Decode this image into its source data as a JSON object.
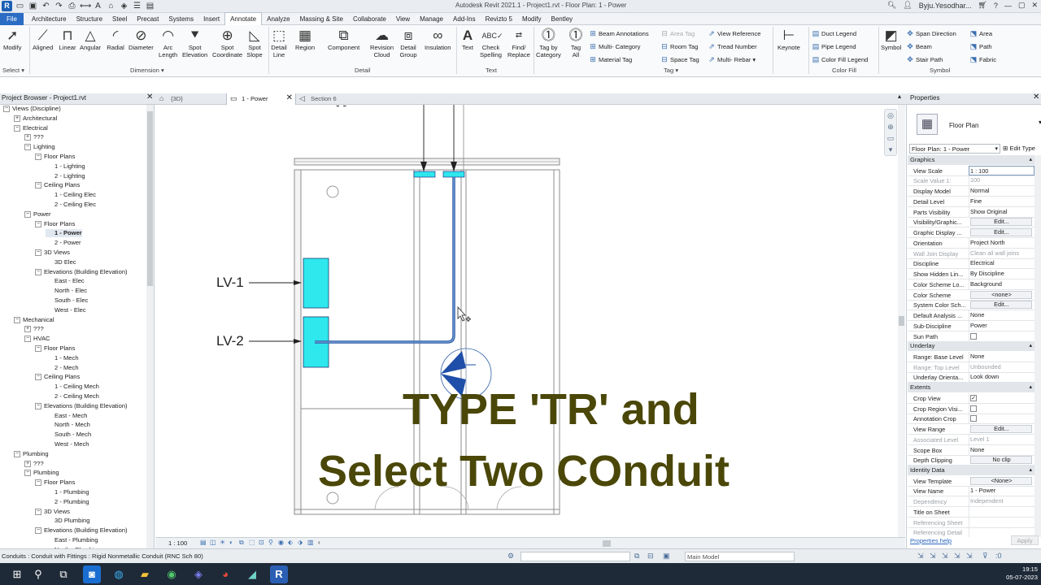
{
  "window": {
    "title": "Autodesk Revit 2021.1 - Project1.rvt - Floor Plan: 1 - Power",
    "user": "Byju.Yesodhar..."
  },
  "tabs": [
    {
      "label": "File"
    },
    {
      "label": "Architecture"
    },
    {
      "label": "Structure"
    },
    {
      "label": "Steel"
    },
    {
      "label": "Precast"
    },
    {
      "label": "Systems"
    },
    {
      "label": "Insert"
    },
    {
      "label": "Annotate"
    },
    {
      "label": "Analyze"
    },
    {
      "label": "Massing & Site"
    },
    {
      "label": "Collaborate"
    },
    {
      "label": "View"
    },
    {
      "label": "Manage"
    },
    {
      "label": "Add-Ins"
    },
    {
      "label": "Revizto 5"
    },
    {
      "label": "Modify"
    },
    {
      "label": "Bentley"
    }
  ],
  "ribbon": {
    "buttons": {
      "modify": "Modify",
      "aligned": "Aligned",
      "linear": "Linear",
      "angular": "Angular",
      "radial": "Radial",
      "diameter": "Diameter",
      "arc_length_1": "Arc",
      "arc_length_2": "Length",
      "spot_elev_1": "Spot",
      "spot_elev_2": "Elevation",
      "spot_coord_1": "Spot",
      "spot_coord_2": "Coordinate",
      "spot_slope_1": "Spot",
      "spot_slope_2": "Slope",
      "detail_line_1": "Detail",
      "detail_line_2": "Line",
      "region": "Region",
      "component": "Component",
      "rev_cloud_1": "Revision",
      "rev_cloud_2": "Cloud",
      "detail_group_1": "Detail",
      "detail_group_2": "Group",
      "insulation": "Insulation",
      "text": "Text",
      "check_spelling_1": "Check",
      "check_spelling_2": "Spelling",
      "find_replace_1": "Find/",
      "find_replace_2": "Replace",
      "tag_by_cat_1": "Tag by",
      "tag_by_cat_2": "Category",
      "tag_all_1": "Tag",
      "tag_all_2": "All",
      "keynote": "Keynote",
      "symbol": "Symbol"
    },
    "small": {
      "beam_ann": "Beam  Annotations",
      "multi_cat": "Multi- Category",
      "material_tag": "Material  Tag",
      "area_tag": "Area  Tag",
      "room_tag": "Room  Tag",
      "space_tag": "Space  Tag",
      "view_ref": "View  Reference",
      "tread_num": "Tread  Number",
      "multi_rebar": "Multi- Rebar",
      "duct_legend": "Duct  Legend",
      "pipe_legend": "Pipe  Legend",
      "color_fill_legend": "Color Fill  Legend",
      "span_dir": "Span  Direction",
      "beam": "Beam",
      "stair_path": "Stair  Path",
      "area": "Area",
      "path": "Path",
      "fabric": "Fabric"
    },
    "panels": {
      "select": "Select ▾",
      "dimension": "Dimension ▾",
      "detail": "Detail",
      "text": "Text",
      "tag": "Tag ▾",
      "color_fill": "Color Fill",
      "symbol": "Symbol"
    }
  },
  "browser": {
    "title": "Project Browser - Project1.rvt",
    "nodes": [
      {
        "label": "Views (Discipline)",
        "lvl": 0,
        "ex": "−"
      },
      {
        "label": "Architectural",
        "lvl": 1,
        "ex": "+"
      },
      {
        "label": "Electrical",
        "lvl": 1,
        "ex": "−"
      },
      {
        "label": "???",
        "lvl": 2,
        "ex": "+"
      },
      {
        "label": "Lighting",
        "lvl": 2,
        "ex": "−"
      },
      {
        "label": "Floor Plans",
        "lvl": 3,
        "ex": "−"
      },
      {
        "label": "1 - Lighting",
        "lvl": 4
      },
      {
        "label": "2 - Lighting",
        "lvl": 4
      },
      {
        "label": "Ceiling Plans",
        "lvl": 3,
        "ex": "−"
      },
      {
        "label": "1 - Ceiling Elec",
        "lvl": 4
      },
      {
        "label": "2 - Ceiling Elec",
        "lvl": 4
      },
      {
        "label": "Power",
        "lvl": 2,
        "ex": "−"
      },
      {
        "label": "Floor Plans",
        "lvl": 3,
        "ex": "−"
      },
      {
        "label": "1 - Power",
        "lvl": 4,
        "sel": true
      },
      {
        "label": "2 - Power",
        "lvl": 4
      },
      {
        "label": "3D Views",
        "lvl": 3,
        "ex": "−"
      },
      {
        "label": "3D Elec",
        "lvl": 4
      },
      {
        "label": "Elevations (Building Elevation)",
        "lvl": 3,
        "ex": "−"
      },
      {
        "label": "East - Elec",
        "lvl": 4
      },
      {
        "label": "North - Elec",
        "lvl": 4
      },
      {
        "label": "South - Elec",
        "lvl": 4
      },
      {
        "label": "West - Elec",
        "lvl": 4
      },
      {
        "label": "Mechanical",
        "lvl": 1,
        "ex": "−"
      },
      {
        "label": "???",
        "lvl": 2,
        "ex": "+"
      },
      {
        "label": "HVAC",
        "lvl": 2,
        "ex": "−"
      },
      {
        "label": "Floor Plans",
        "lvl": 3,
        "ex": "−"
      },
      {
        "label": "1 - Mech",
        "lvl": 4
      },
      {
        "label": "2 - Mech",
        "lvl": 4
      },
      {
        "label": "Ceiling Plans",
        "lvl": 3,
        "ex": "−"
      },
      {
        "label": "1 - Ceiling Mech",
        "lvl": 4
      },
      {
        "label": "2 - Ceiling Mech",
        "lvl": 4
      },
      {
        "label": "Elevations (Building Elevation)",
        "lvl": 3,
        "ex": "−"
      },
      {
        "label": "East - Mech",
        "lvl": 4
      },
      {
        "label": "North - Mech",
        "lvl": 4
      },
      {
        "label": "South - Mech",
        "lvl": 4
      },
      {
        "label": "West - Mech",
        "lvl": 4
      },
      {
        "label": "Plumbing",
        "lvl": 1,
        "ex": "−"
      },
      {
        "label": "???",
        "lvl": 2,
        "ex": "+"
      },
      {
        "label": "Plumbing",
        "lvl": 2,
        "ex": "−"
      },
      {
        "label": "Floor Plans",
        "lvl": 3,
        "ex": "−"
      },
      {
        "label": "1 - Plumbing",
        "lvl": 4
      },
      {
        "label": "2 - Plumbing",
        "lvl": 4
      },
      {
        "label": "3D Views",
        "lvl": 3,
        "ex": "−"
      },
      {
        "label": "3D Plumbing",
        "lvl": 4
      },
      {
        "label": "Elevations (Building Elevation)",
        "lvl": 3,
        "ex": "−"
      },
      {
        "label": "East - Plumbing",
        "lvl": 4
      },
      {
        "label": "North - Plumbing",
        "lvl": 4
      }
    ]
  },
  "view_tabs": [
    {
      "label": "{3D}"
    },
    {
      "label": "1 - Power",
      "active": true
    },
    {
      "label": "Section 6"
    }
  ],
  "canvas": {
    "label_lv1": "LV-1",
    "label_lv2": "LV-2",
    "tag_top": "- -"
  },
  "overlay": {
    "line1": "TYPE 'TR' and",
    "line2": "Select Two COnduit"
  },
  "view_control": {
    "scale": "1 : 100"
  },
  "properties": {
    "title": "Properties",
    "type_name": "Floor Plan",
    "instance": "Floor Plan: 1 - Power",
    "edit_type": "Edit Type",
    "help": "Properties help",
    "apply": "Apply",
    "rows": [
      {
        "kind": "h",
        "label": "Graphics"
      },
      {
        "kind": "r",
        "k": "View Scale",
        "v": "1 : 100",
        "style": "inp"
      },
      {
        "kind": "r",
        "k": "Scale Value    1:",
        "v": "100",
        "dim": true
      },
      {
        "kind": "r",
        "k": "Display Model",
        "v": "Normal"
      },
      {
        "kind": "r",
        "k": "Detail Level",
        "v": "Fine"
      },
      {
        "kind": "r",
        "k": "Parts Visibility",
        "v": "Show Original"
      },
      {
        "kind": "r",
        "k": "Visibility/Graphic...",
        "v": "Edit...",
        "style": "btn"
      },
      {
        "kind": "r",
        "k": "Graphic Display ...",
        "v": "Edit...",
        "style": "btn"
      },
      {
        "kind": "r",
        "k": "Orientation",
        "v": "Project North"
      },
      {
        "kind": "r",
        "k": "Wall Join Display",
        "v": "Clean all wall joins",
        "dim": true
      },
      {
        "kind": "r",
        "k": "Discipline",
        "v": "Electrical"
      },
      {
        "kind": "r",
        "k": "Show Hidden Lin...",
        "v": "By Discipline"
      },
      {
        "kind": "r",
        "k": "Color Scheme Lo...",
        "v": "Background"
      },
      {
        "kind": "r",
        "k": "Color Scheme",
        "v": "<none>",
        "style": "btn"
      },
      {
        "kind": "r",
        "k": "System Color Sch...",
        "v": "Edit...",
        "style": "btn"
      },
      {
        "kind": "r",
        "k": "Default Analysis ...",
        "v": "None"
      },
      {
        "kind": "r",
        "k": "Sub-Discipline",
        "v": "Power"
      },
      {
        "kind": "r",
        "k": "Sun Path",
        "v": "",
        "style": "chk",
        "checked": false
      },
      {
        "kind": "h",
        "label": "Underlay"
      },
      {
        "kind": "r",
        "k": "Range: Base Level",
        "v": "None"
      },
      {
        "kind": "r",
        "k": "Range: Top Level",
        "v": "Unbounded",
        "dim": true
      },
      {
        "kind": "r",
        "k": "Underlay Orienta...",
        "v": "Look down"
      },
      {
        "kind": "h",
        "label": "Extents"
      },
      {
        "kind": "r",
        "k": "Crop View",
        "v": "",
        "style": "chk",
        "checked": true
      },
      {
        "kind": "r",
        "k": "Crop Region Visi...",
        "v": "",
        "style": "chk",
        "checked": false
      },
      {
        "kind": "r",
        "k": "Annotation Crop",
        "v": "",
        "style": "chk",
        "checked": false
      },
      {
        "kind": "r",
        "k": "View Range",
        "v": "Edit...",
        "style": "btn"
      },
      {
        "kind": "r",
        "k": "Associated Level",
        "v": "Level 1",
        "dim": true
      },
      {
        "kind": "r",
        "k": "Scope Box",
        "v": "None"
      },
      {
        "kind": "r",
        "k": "Depth Clipping",
        "v": "No clip",
        "style": "btn"
      },
      {
        "kind": "h",
        "label": "Identity Data"
      },
      {
        "kind": "r",
        "k": "View Template",
        "v": "<None>",
        "style": "btn"
      },
      {
        "kind": "r",
        "k": "View Name",
        "v": "1 - Power"
      },
      {
        "kind": "r",
        "k": "Dependency",
        "v": "Independent",
        "dim": true
      },
      {
        "kind": "r",
        "k": "Title on Sheet",
        "v": ""
      },
      {
        "kind": "r",
        "k": "Referencing Sheet",
        "v": "",
        "dim": true
      },
      {
        "kind": "r",
        "k": "Referencing Detail",
        "v": "",
        "dim": true
      }
    ]
  },
  "status": {
    "text": "Conduits : Conduit with Fittings : Rigid Nonmetallic Conduit (RNC Sch 80)",
    "model": "Main Model"
  },
  "taskbar": {
    "time": "19:15",
    "date": "05-07-2023"
  },
  "colors": {
    "equipment": "#2ee8ee",
    "conduit": "#2f5fa8",
    "overlay_text": "#4a4708",
    "accent": "#2b6cc4"
  }
}
